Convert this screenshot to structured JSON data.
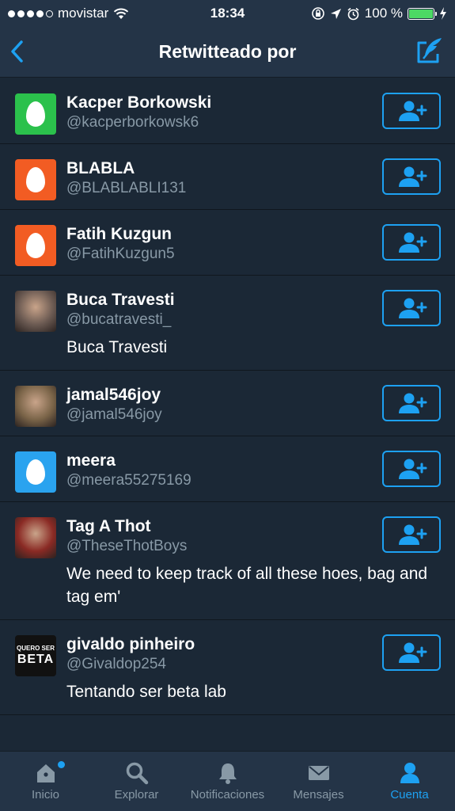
{
  "status": {
    "carrier": "movistar",
    "time": "18:34",
    "battery": "100 %",
    "battery_level": 1.0
  },
  "nav": {
    "title": "Retwitteado por"
  },
  "colors": {
    "accent": "#1da1f2",
    "background": "#1b2836",
    "bar": "#243447",
    "muted": "#8899a6"
  },
  "users": [
    {
      "name": "Kacper Borkowski",
      "handle": "@kacperborkowsk6",
      "bio": "",
      "avatar": "egg",
      "avatar_color": "#2bc14c"
    },
    {
      "name": "BLABLA",
      "handle": "@BLABLABLI131",
      "bio": "",
      "avatar": "egg",
      "avatar_color": "#f25c23"
    },
    {
      "name": "Fatih Kuzgun",
      "handle": "@FatihKuzgun5",
      "bio": "",
      "avatar": "egg",
      "avatar_color": "#f25c23"
    },
    {
      "name": "Buca Travesti",
      "handle": "@bucatravesti_",
      "bio": "Buca Travesti",
      "avatar": "photo",
      "avatar_color": "#6b5a52"
    },
    {
      "name": "jamal546joy",
      "handle": "@jamal546joy",
      "bio": "",
      "avatar": "photo",
      "avatar_color": "#7a6448"
    },
    {
      "name": "meera",
      "handle": "@meera55275169",
      "bio": "",
      "avatar": "egg",
      "avatar_color": "#2aa3ef"
    },
    {
      "name": "Tag A Thot",
      "handle": "@TheseThotBoys",
      "bio": "We need to keep track of all these hoes, bag and tag em'",
      "avatar": "photo",
      "avatar_color": "#8a2a24"
    },
    {
      "name": "givaldo pinheiro",
      "handle": "@Givaldop254",
      "bio": "Tentando ser beta lab",
      "avatar": "text",
      "avatar_color": "#111111",
      "avatar_text_top": "QUERO SER",
      "avatar_text_bottom": "BETA"
    }
  ],
  "tabs": [
    {
      "label": "Inicio",
      "icon": "home-icon",
      "active": false
    },
    {
      "label": "Explorar",
      "icon": "search-icon",
      "active": false
    },
    {
      "label": "Notificaciones",
      "icon": "bell-icon",
      "active": false
    },
    {
      "label": "Mensajes",
      "icon": "envelope-icon",
      "active": false
    },
    {
      "label": "Cuenta",
      "icon": "person-icon",
      "active": true
    }
  ]
}
